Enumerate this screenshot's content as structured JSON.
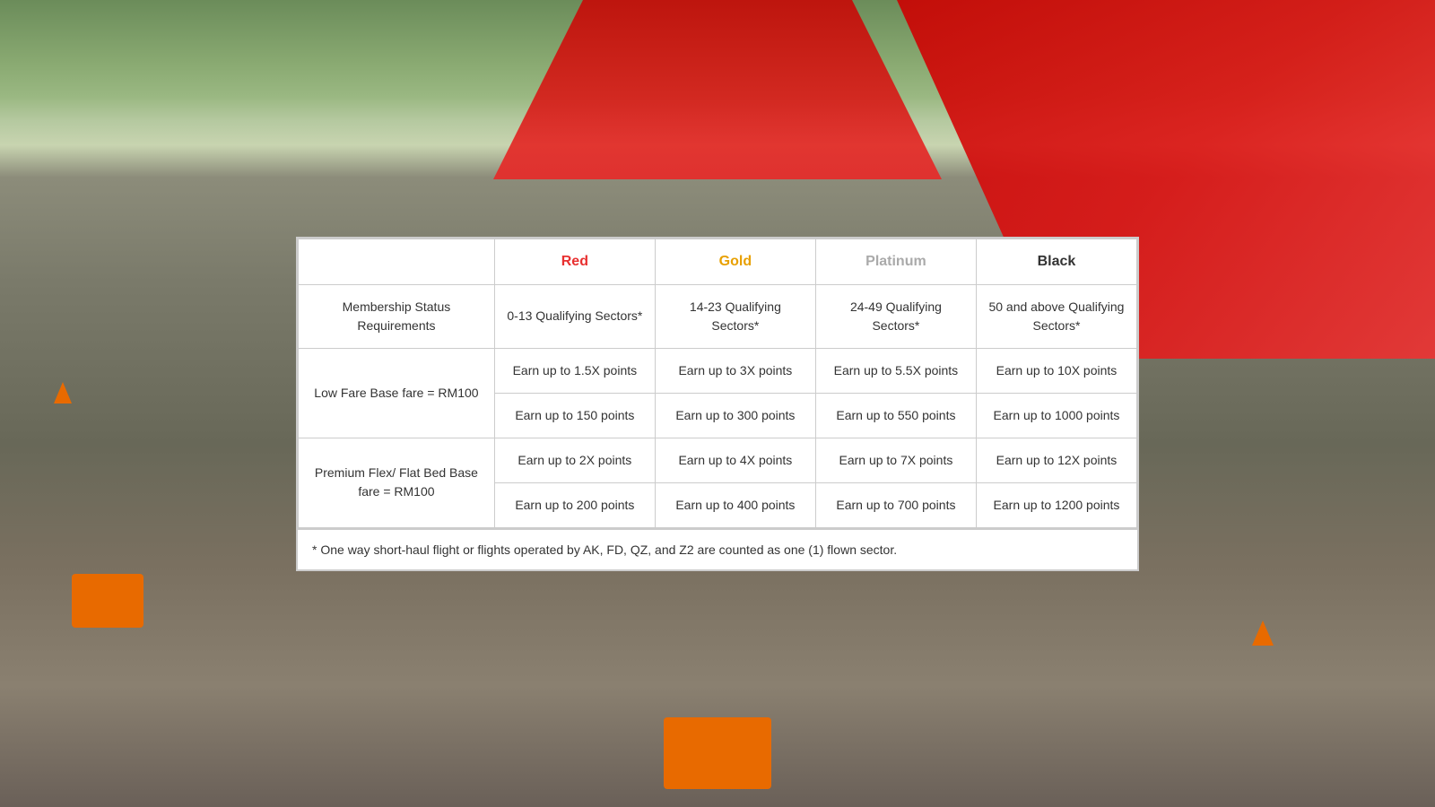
{
  "background": {
    "description": "Airport tarmac with AirAsia plane"
  },
  "table": {
    "columns": [
      {
        "id": "label",
        "text": ""
      },
      {
        "id": "red",
        "text": "Red",
        "color_class": "col-header-red"
      },
      {
        "id": "gold",
        "text": "Gold",
        "color_class": "col-header-gold"
      },
      {
        "id": "platinum",
        "text": "Platinum",
        "color_class": "col-header-platinum"
      },
      {
        "id": "black",
        "text": "Black",
        "color_class": "col-header-black"
      }
    ],
    "rows": [
      {
        "id": "membership-status",
        "label": "Membership Status Requirements",
        "cells": [
          "0-13 Qualifying Sectors*",
          "14-23 Qualifying Sectors*",
          "24-49 Qualifying Sectors*",
          "50 and above Qualifying Sectors*"
        ]
      },
      {
        "id": "low-fare",
        "label": "Low Fare Base fare = RM100",
        "sub_rows": [
          [
            "Earn up to 1.5X points",
            "Earn up to 3X points",
            "Earn up to 5.5X points",
            "Earn up to 10X points"
          ],
          [
            "Earn up to 150 points",
            "Earn up to 300 points",
            "Earn up to 550 points",
            "Earn up to 1000 points"
          ]
        ]
      },
      {
        "id": "premium-flex",
        "label": "Premium Flex/ Flat Bed Base fare = RM100",
        "sub_rows": [
          [
            "Earn up to 2X points",
            "Earn up to 4X points",
            "Earn up to 7X points",
            "Earn up to 12X points"
          ],
          [
            "Earn up to 200 points",
            "Earn up to 400 points",
            "Earn up to 700 points",
            "Earn up to 1200 points"
          ]
        ]
      }
    ],
    "footnote": "* One way short-haul flight or flights operated by AK, FD, QZ, and Z2 are counted as one (1) flown sector."
  }
}
